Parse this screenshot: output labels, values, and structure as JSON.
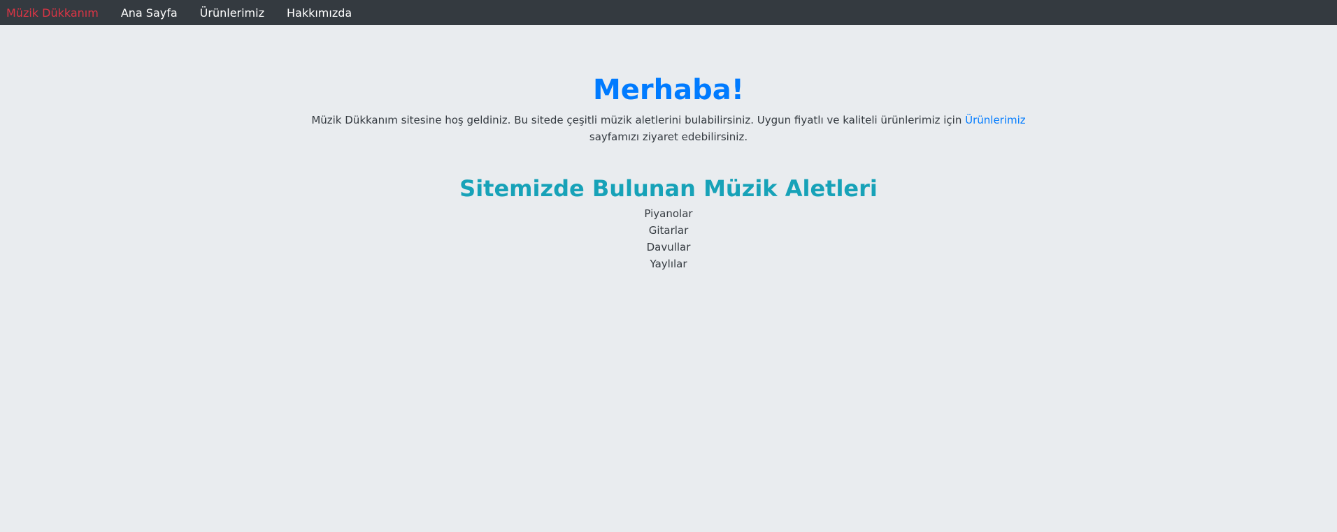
{
  "navbar": {
    "brand": "Müzik Dükkanım",
    "links": [
      "Ana Sayfa",
      "Ürünlerimiz",
      "Hakkımızda"
    ]
  },
  "hero": {
    "title": "Merhaba!",
    "text_before_link": "Müzik Dükkanım sitesine hoş geldiniz. Bu sitede çeşitli müzik aletlerini bulabilirsiniz. Uygun fiyatlı ve kaliteli ürünlerimiz için ",
    "link_text": "Ürünlerimiz",
    "text_after_link": " sayfamızı ziyaret edebilirsiniz."
  },
  "instruments": {
    "title": "Sitemizde Bulunan Müzik Aletleri",
    "items": [
      "Piyanolar",
      "Gitarlar",
      "Davullar",
      "Yaylılar"
    ]
  },
  "colors": {
    "navbar_bg": "#343a40",
    "brand": "#dc3545",
    "hero_title": "#007bff",
    "section_title": "#17a2b8",
    "page_bg": "#e9ecef"
  }
}
